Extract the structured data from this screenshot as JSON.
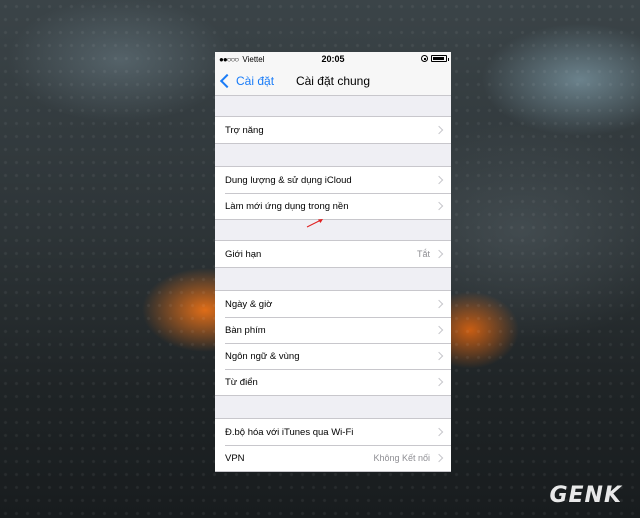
{
  "status": {
    "carrier": "Viettel",
    "time": "20:05",
    "signal_dots": "●●○○○"
  },
  "nav": {
    "back_label": "Cài đặt",
    "title": "Cài đặt chung"
  },
  "rows": {
    "accessibility": {
      "label": "Trợ năng"
    },
    "storage": {
      "label": "Dung lượng & sử dụng iCloud"
    },
    "bg_refresh": {
      "label": "Làm mới ứng dụng trong nền"
    },
    "restrictions": {
      "label": "Giới hạn",
      "value": "Tắt"
    },
    "datetime": {
      "label": "Ngày & giờ"
    },
    "keyboard": {
      "label": "Bàn phím"
    },
    "language": {
      "label": "Ngôn ngữ & vùng"
    },
    "dictionary": {
      "label": "Từ điển"
    },
    "itunes_sync": {
      "label": "Đ.bộ hóa với iTunes qua Wi-Fi"
    },
    "vpn": {
      "label": "VPN",
      "value": "Không Kết nối"
    }
  },
  "watermark": {
    "text": "GENK"
  },
  "colors": {
    "accent": "#1a7cf7",
    "annotation_arrow": "#e02020"
  }
}
